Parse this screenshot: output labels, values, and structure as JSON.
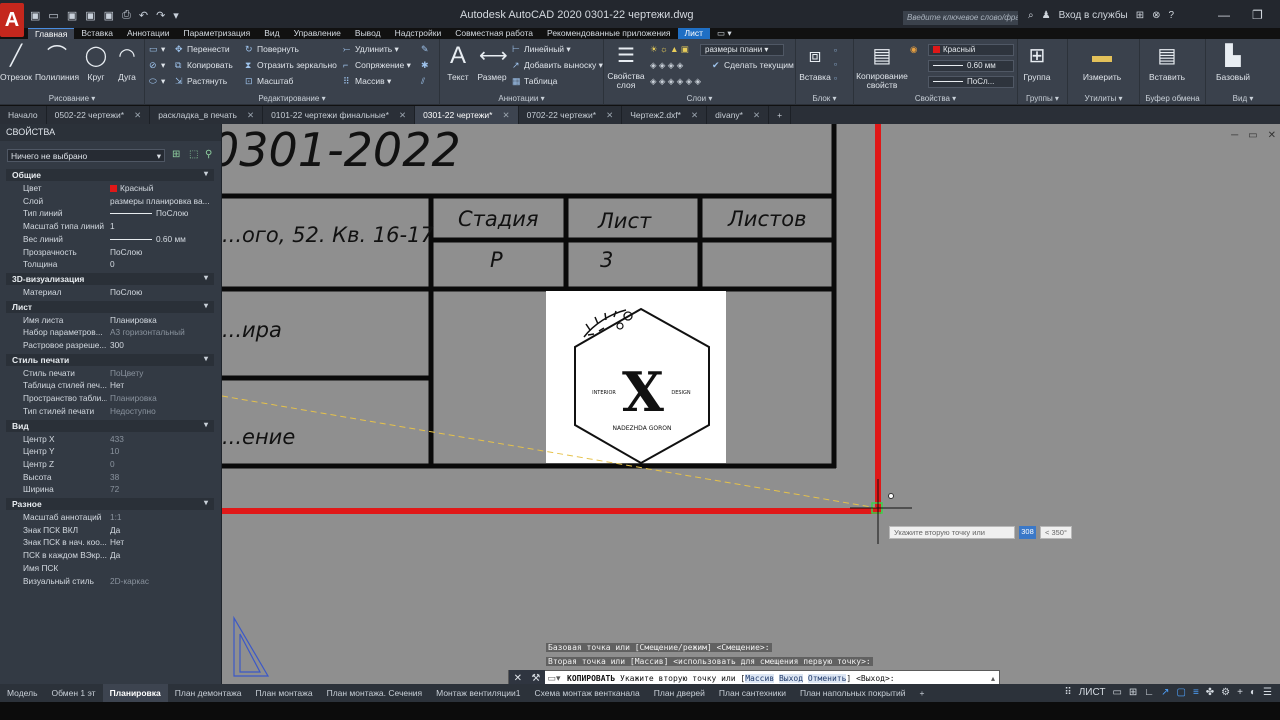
{
  "app": {
    "logo": "A",
    "title": "Autodesk AutoCAD 2020   0301-22 чертежи.dwg",
    "search_placeholder": "Введите ключевое слово/фразу",
    "login": "Вход в службы",
    "quick_access": [
      "▣",
      "▭",
      "▣",
      "▣",
      "▣",
      "⎙",
      "↶",
      "↷",
      "▾"
    ],
    "win_controls": [
      "—",
      "❐",
      "✕"
    ]
  },
  "ribbon_tabs": [
    "Главная",
    "Вставка",
    "Аннотации",
    "Параметризация",
    "Вид",
    "Управление",
    "Вывод",
    "Надстройки",
    "Совместная работа",
    "Рекомендованные приложения",
    "Лист",
    "▭ ▾"
  ],
  "ribbon": {
    "draw": {
      "title": "Рисование ▾",
      "line": "Отрезок",
      "polyline": "Полилиния",
      "circle": "Круг",
      "arc": "Дуга"
    },
    "modify": {
      "title": "Редактирование ▾",
      "move": "Перенести",
      "copy": "Копировать",
      "stretch": "Растянуть",
      "rotate": "Повернуть",
      "mirror": "Отразить зеркально",
      "scale": "Масштаб",
      "trim": "Удлинить ▾",
      "fillet": "Сопряжение ▾",
      "array": "Массив ▾"
    },
    "annotation": {
      "title": "Аннотации ▾",
      "text": "Текст",
      "dimension": "Размер",
      "linear": "Линейный ▾",
      "leader": "Добавить выноску ▾",
      "table": "Таблица"
    },
    "layers": {
      "title": "Слои ▾",
      "props": "Свойства слоя",
      "current_layer": "размеры плани",
      "make_current": "Сделать текущим"
    },
    "block": {
      "title": "Блок ▾",
      "insert": "Вставка"
    },
    "properties": {
      "title": "Свойства ▾",
      "match": "Копирование свойств",
      "color": "Красный",
      "lineweight": "0.60 мм",
      "linetype": "ПоСл..."
    },
    "groups": {
      "title": "Группы ▾",
      "group": "Группа"
    },
    "utilities": {
      "title": "Утилиты ▾",
      "measure": "Измерить"
    },
    "clipboard": {
      "title": "Буфер обмена",
      "paste": "Вставить"
    },
    "view": {
      "title": "Вид ▾",
      "base": "Базовый"
    }
  },
  "doc_tabs": [
    {
      "label": "Начало",
      "active": false,
      "close": false
    },
    {
      "label": "0502-22 чертежи*",
      "active": false,
      "close": true
    },
    {
      "label": "раскладка_в печать",
      "active": false,
      "close": true
    },
    {
      "label": "0101-22 чертежи финальные*",
      "active": false,
      "close": true
    },
    {
      "label": "0301-22 чертежи*",
      "active": true,
      "close": true
    },
    {
      "label": "0702-22 чертежи*",
      "active": false,
      "close": true
    },
    {
      "label": "Чертеж2.dxf*",
      "active": false,
      "close": true
    },
    {
      "label": "divany*",
      "active": false,
      "close": true
    },
    {
      "label": "+",
      "active": false,
      "close": false
    }
  ],
  "properties": {
    "title": "СВОЙСТВА",
    "selection": "Ничего не выбрано",
    "sections": [
      {
        "title": "Общие",
        "rows": [
          {
            "k": "Цвет",
            "v": "Красный",
            "swatch": "#e01818"
          },
          {
            "k": "Слой",
            "v": "размеры планировка ва..."
          },
          {
            "k": "Тип линий",
            "v": "ПоСлою",
            "line": true
          },
          {
            "k": "Масштаб типа линий",
            "v": "1"
          },
          {
            "k": "Вес линий",
            "v": "0.60 мм",
            "line": true
          },
          {
            "k": "Прозрачность",
            "v": "ПоСлою"
          },
          {
            "k": "Толщина",
            "v": "0"
          }
        ]
      },
      {
        "title": "3D-визуализация",
        "rows": [
          {
            "k": "Материал",
            "v": "ПоСлою"
          }
        ]
      },
      {
        "title": "Лист",
        "rows": [
          {
            "k": "Имя листа",
            "v": "Планировка"
          },
          {
            "k": "Набор параметров...",
            "v": "А3 горизонтальный",
            "dim": true
          },
          {
            "k": "Растровое разреше...",
            "v": "300"
          }
        ]
      },
      {
        "title": "Стиль печати",
        "rows": [
          {
            "k": "Стиль печати",
            "v": "ПоЦвету",
            "dim": true
          },
          {
            "k": "Таблица стилей печ...",
            "v": "Нет"
          },
          {
            "k": "Пространство табли...",
            "v": "Планировка",
            "dim": true
          },
          {
            "k": "Тип стилей печати",
            "v": "Недоступно",
            "dim": true
          }
        ]
      },
      {
        "title": "Вид",
        "rows": [
          {
            "k": "Центр X",
            "v": "433",
            "dim": true
          },
          {
            "k": "Центр Y",
            "v": "10",
            "dim": true
          },
          {
            "k": "Центр Z",
            "v": "0",
            "dim": true
          },
          {
            "k": "Высота",
            "v": "38",
            "dim": true
          },
          {
            "k": "Ширина",
            "v": "72",
            "dim": true
          }
        ]
      },
      {
        "title": "Разное",
        "rows": [
          {
            "k": "Масштаб аннотаций",
            "v": "1:1",
            "dim": true
          },
          {
            "k": "Знак ПСК ВКЛ",
            "v": "Да"
          },
          {
            "k": "Знак ПСК в нач. коо...",
            "v": "Нет"
          },
          {
            "k": "ПСК в каждом ВЭкр...",
            "v": "Да"
          },
          {
            "k": "Имя ПСК",
            "v": ""
          },
          {
            "k": "Визуальный стиль",
            "v": "2D-каркас",
            "dim": true
          }
        ]
      }
    ]
  },
  "drawing": {
    "number": "0301-2022",
    "address": "...ого, 52. Кв. 16-17",
    "stage_label": "Стадия",
    "sheet_label": "Лист",
    "sheets_label": "Листов",
    "stage_value": "Р",
    "sheet_value": "3",
    "row_text_1": "...ира",
    "row_text_2": "...ение",
    "logo_letter": "X",
    "logo_left": "INTERIOR",
    "logo_right": "DESIGN",
    "logo_name": "NADEZHDA GORON"
  },
  "tooltip": {
    "prompt": "Укажите вторую точку или",
    "value": "308",
    "angle": "< 350°"
  },
  "command": {
    "history1": "Базовая точка или [Смещение/режим] <Смещение>:",
    "history2": "Вторая точка или [Массив] <использовать для смещения первую точку>:",
    "name": "КОПИРОВАТЬ",
    "prompt": "Укажите вторую точку или",
    "opt1": "Массив",
    "opt2": "Выход",
    "opt3": "Отменить",
    "tail": "<Выход>:"
  },
  "layout_tabs": [
    "Модель",
    "Обмен 1 эт",
    "Планировка",
    "План демонтажа",
    "План монтажа",
    "План монтажа. Сечения",
    "Монтаж вентиляции1",
    "Схема монтаж вентканала",
    "План дверей",
    "План сантехники",
    "План напольных покрытий",
    "+"
  ],
  "active_layout": "Планировка",
  "status": {
    "mode": "ЛИСТ"
  },
  "colors": {
    "red": "#e01818",
    "accent": "#1f6fc4",
    "canvas": "#8f8f8f"
  }
}
